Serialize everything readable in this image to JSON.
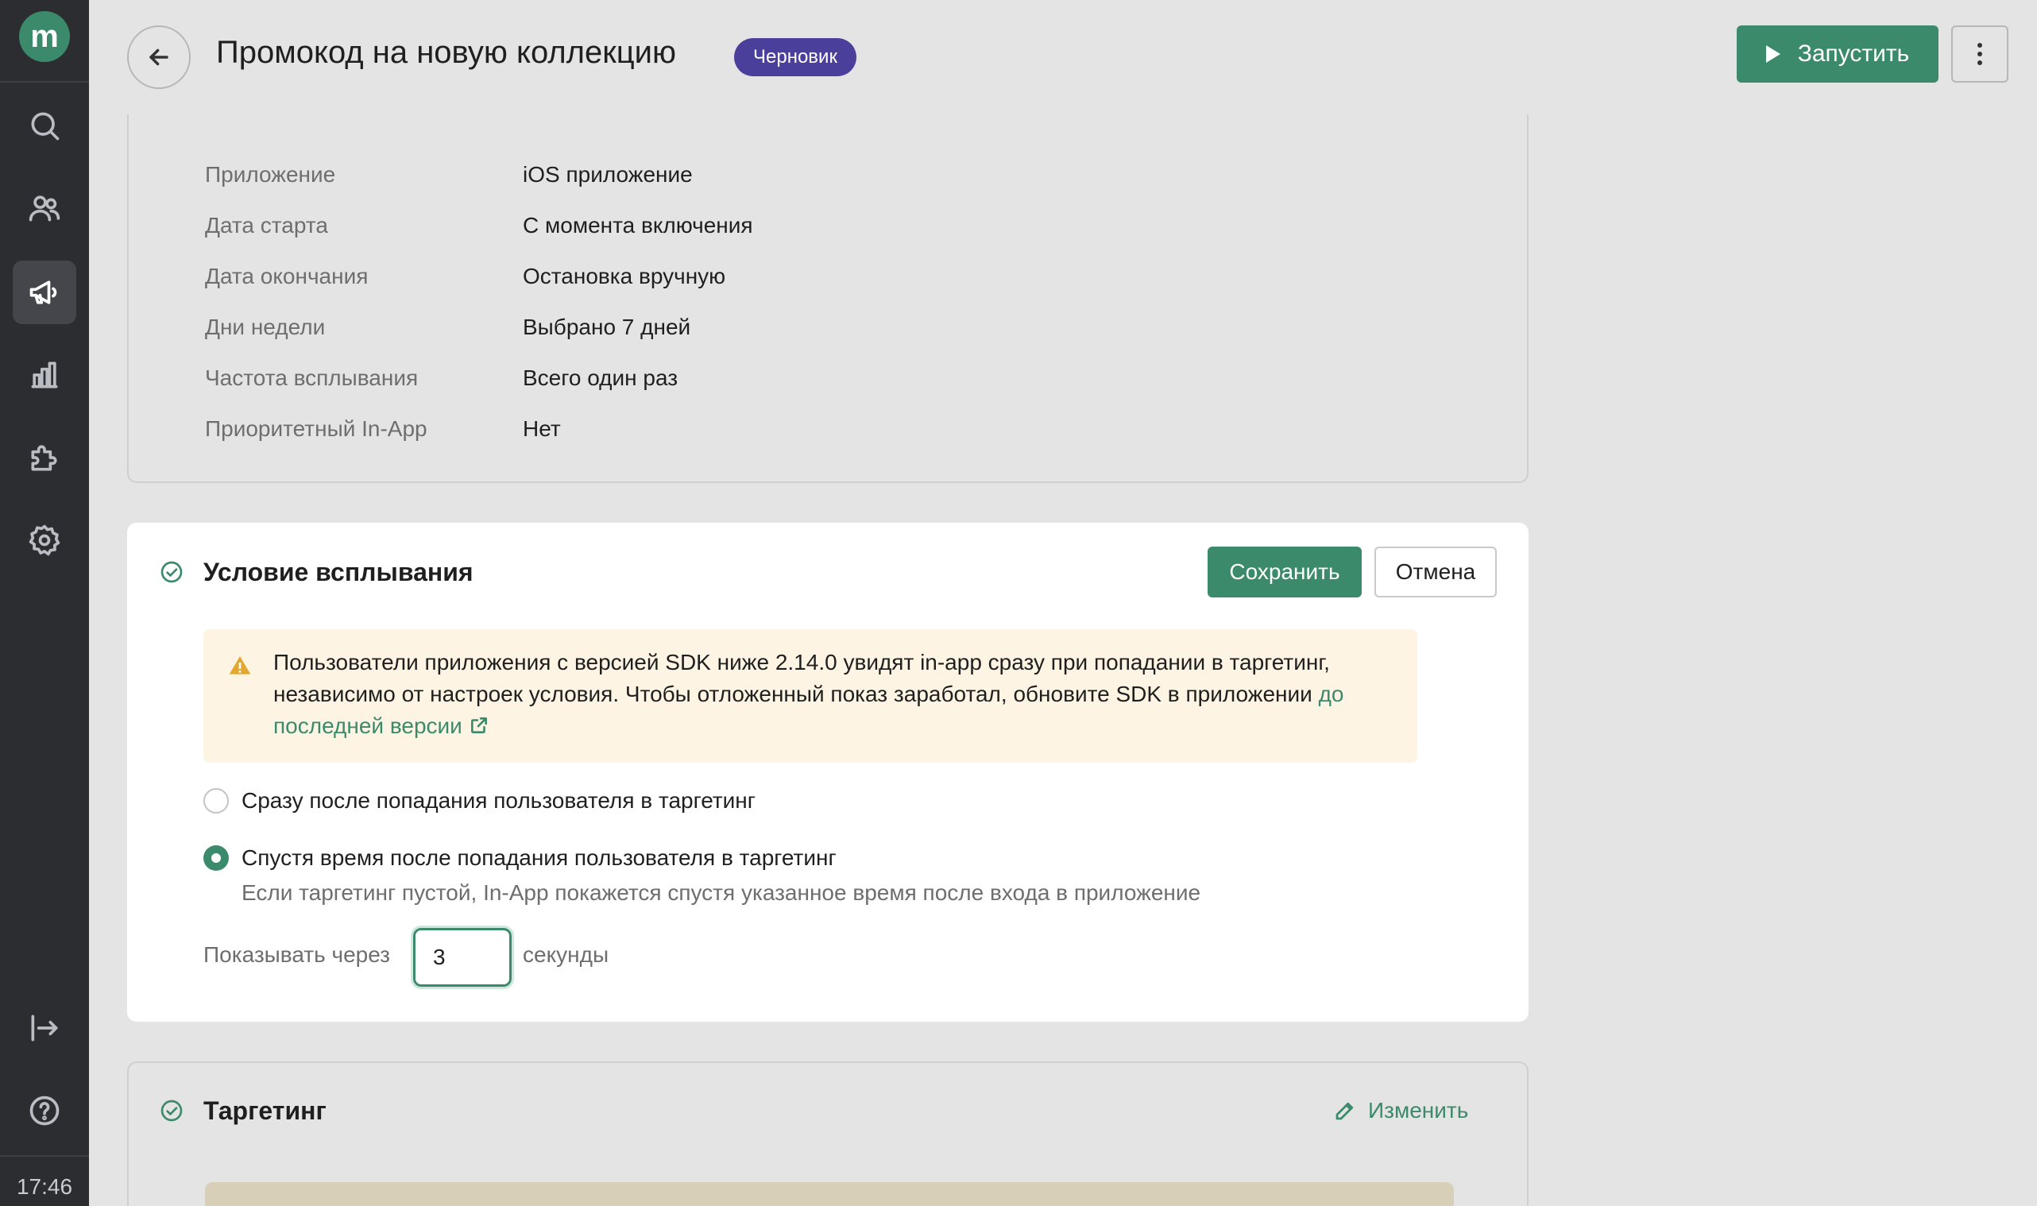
{
  "sidebar": {
    "logo_letter": "m",
    "items": [
      {
        "name": "search-icon"
      },
      {
        "name": "users-icon"
      },
      {
        "name": "megaphone-icon",
        "active": true
      },
      {
        "name": "bar-chart-icon"
      },
      {
        "name": "puzzle-icon"
      },
      {
        "name": "gear-icon"
      }
    ],
    "bottom_items": [
      {
        "name": "logout-icon"
      },
      {
        "name": "help-icon"
      }
    ],
    "clock": "17:46"
  },
  "header": {
    "title": "Промокод на новую коллекцию",
    "status": "Черновик",
    "launch_label": "Запустить"
  },
  "settings_summary": {
    "rows": [
      {
        "label": "Приложение",
        "value": "iOS приложение"
      },
      {
        "label": "Дата старта",
        "value": "С момента включения"
      },
      {
        "label": "Дата окончания",
        "value": "Остановка вручную"
      },
      {
        "label": "Дни недели",
        "value": "Выбрано 7 дней"
      },
      {
        "label": "Частота всплывания",
        "value": "Всего один раз"
      },
      {
        "label": "Приоритетный In-App",
        "value": "Нет"
      }
    ]
  },
  "condition": {
    "title": "Условие всплывания",
    "save_label": "Сохранить",
    "cancel_label": "Отмена",
    "warning_text": "Пользователи приложения с версией SDK ниже 2.14.0 увидят in-app сразу при попадании в таргетинг, независимо от настроек условия. Чтобы отложенный показ заработал, обновите SDK в приложении ",
    "warning_link": "до последней версии",
    "options": [
      {
        "label": "Сразу после попадания пользователя в таргетинг",
        "checked": false
      },
      {
        "label": "Спустя время после попадания пользователя в таргетинг",
        "checked": true,
        "hint": "Если таргетинг пустой, In-App покажется спустя указанное время после входа в приложение"
      }
    ],
    "delay_label": "Показывать через",
    "delay_value": "3",
    "delay_unit": "секунды"
  },
  "targeting": {
    "title": "Таргетинг",
    "edit_label": "Изменить"
  },
  "colors": {
    "accent": "#3b8a6b",
    "badge": "#4a3f9b",
    "warning_bg": "#fdf4e3",
    "sidebar_bg": "#2c2d30"
  }
}
